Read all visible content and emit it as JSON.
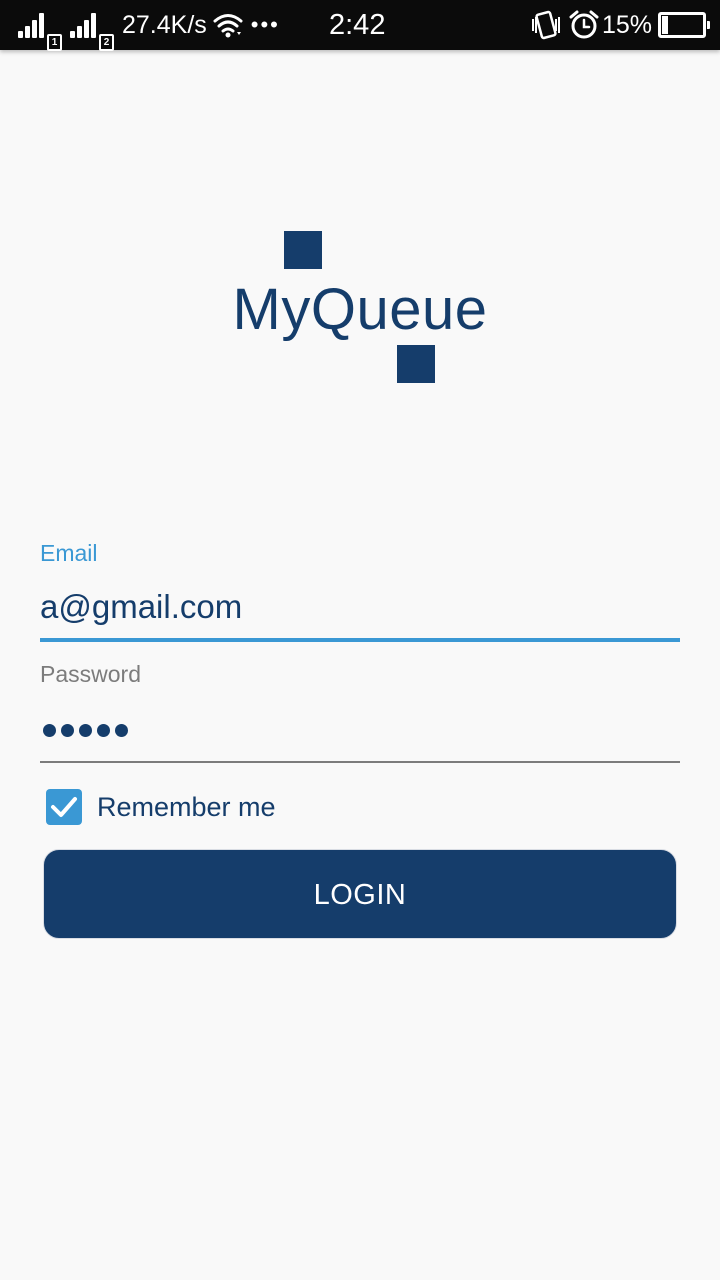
{
  "status_bar": {
    "network_speed": "27.4K/s",
    "sim1_label": "1",
    "sim2_label": "2",
    "more_indicator": "•••",
    "time": "2:42",
    "battery_percent": "15%",
    "battery_level": 0.15,
    "icons": [
      "signal-icon",
      "wifi-icon",
      "vibrate-icon",
      "alarm-icon",
      "battery-icon"
    ]
  },
  "logo": {
    "text": "MyQueue",
    "color": "#153d6b"
  },
  "form": {
    "email": {
      "label": "Email",
      "value": "a@gmail.com",
      "accent_color": "#3a98d4"
    },
    "password": {
      "label": "Password",
      "masked_length": 5
    },
    "remember_me": {
      "label": "Remember me",
      "checked": true
    },
    "login_button": {
      "label": "LOGIN"
    }
  }
}
